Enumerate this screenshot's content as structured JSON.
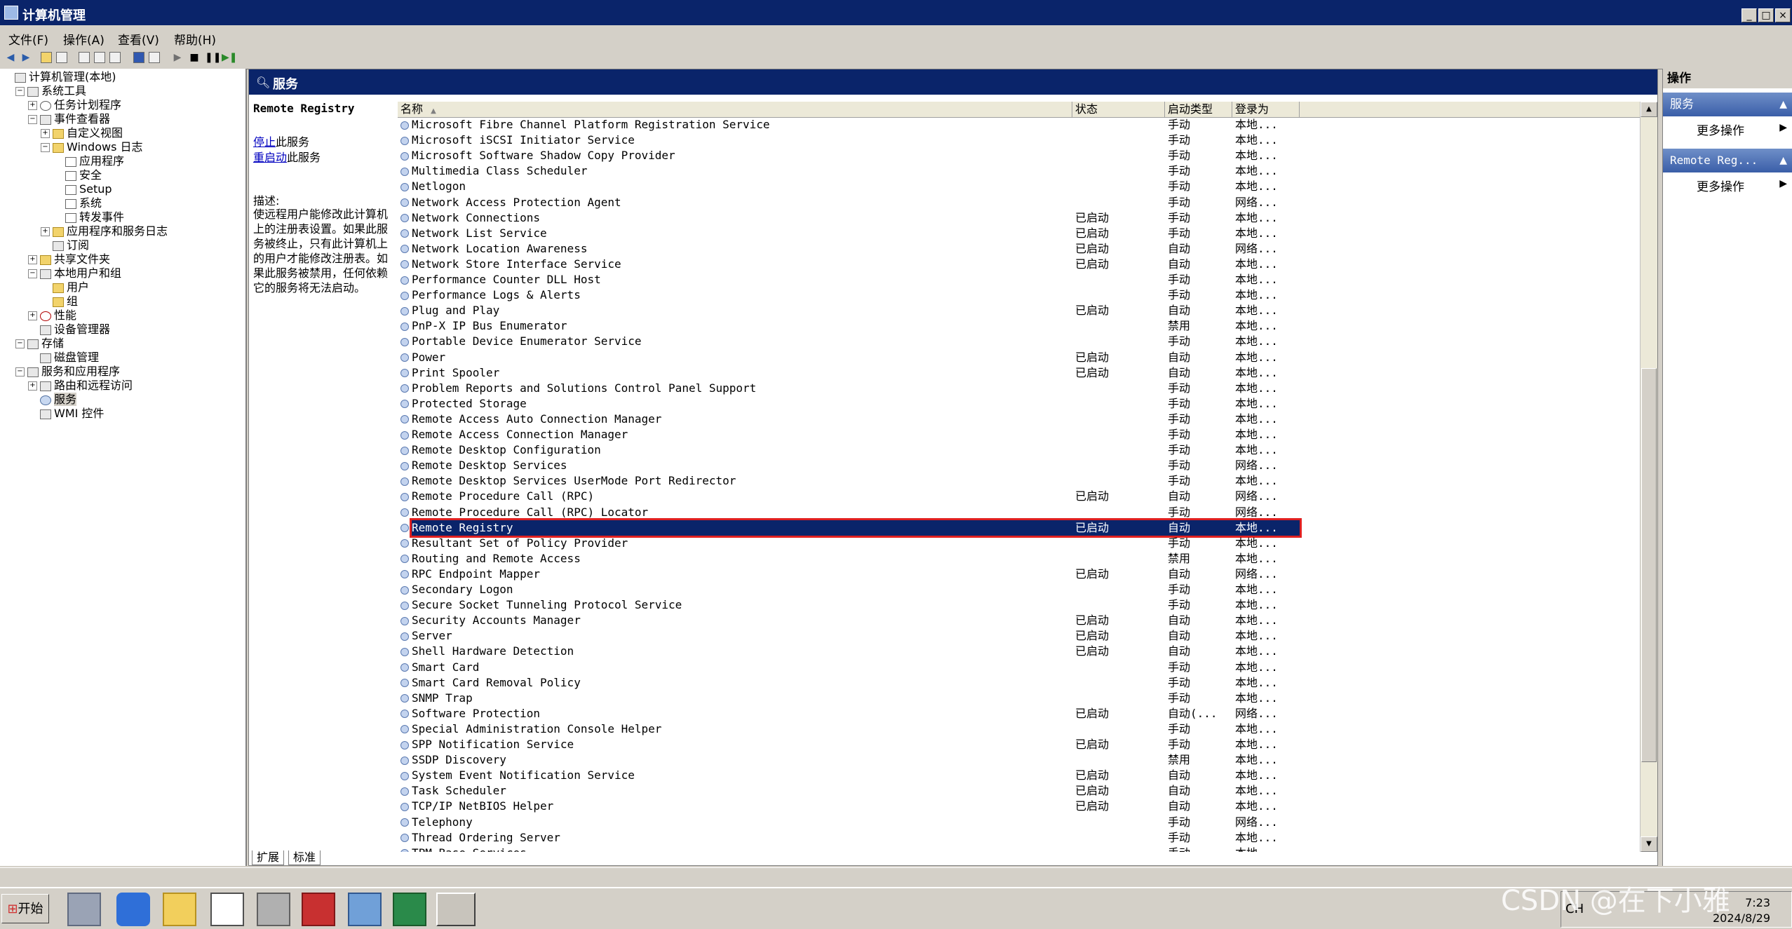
{
  "window": {
    "title": "计算机管理",
    "min": "_",
    "max": "□",
    "close": "×"
  },
  "menu": [
    "文件(F)",
    "操作(A)",
    "查看(V)",
    "帮助(H)"
  ],
  "tree": [
    {
      "label": "计算机管理(本地)",
      "level": 0,
      "icon": "computer-icon",
      "exp": ""
    },
    {
      "label": "系统工具",
      "level": 1,
      "icon": "tools-icon",
      "exp": "⊟"
    },
    {
      "label": "任务计划程序",
      "level": 2,
      "icon": "clock-icon",
      "exp": "⊞"
    },
    {
      "label": "事件查看器",
      "level": 2,
      "icon": "event-viewer-icon",
      "exp": "⊟"
    },
    {
      "label": "自定义视图",
      "level": 3,
      "icon": "folder-icon",
      "exp": "⊞"
    },
    {
      "label": "Windows 日志",
      "level": 3,
      "icon": "folder-icon",
      "exp": "⊟"
    },
    {
      "label": "应用程序",
      "level": 4,
      "icon": "log-icon",
      "exp": ""
    },
    {
      "label": "安全",
      "level": 4,
      "icon": "log-icon",
      "exp": ""
    },
    {
      "label": "Setup",
      "level": 4,
      "icon": "log-icon",
      "exp": ""
    },
    {
      "label": "系统",
      "level": 4,
      "icon": "log-icon",
      "exp": ""
    },
    {
      "label": "转发事件",
      "level": 4,
      "icon": "log-icon",
      "exp": ""
    },
    {
      "label": "应用程序和服务日志",
      "level": 3,
      "icon": "folder-icon",
      "exp": "⊞"
    },
    {
      "label": "订阅",
      "level": 3,
      "icon": "subscription-icon",
      "exp": ""
    },
    {
      "label": "共享文件夹",
      "level": 2,
      "icon": "shared-folder-icon",
      "exp": "⊞"
    },
    {
      "label": "本地用户和组",
      "level": 2,
      "icon": "users-icon",
      "exp": "⊟"
    },
    {
      "label": "用户",
      "level": 3,
      "icon": "folder-icon",
      "exp": ""
    },
    {
      "label": "组",
      "level": 3,
      "icon": "folder-icon",
      "exp": ""
    },
    {
      "label": "性能",
      "level": 2,
      "icon": "performance-icon",
      "exp": "⊞"
    },
    {
      "label": "设备管理器",
      "level": 2,
      "icon": "device-manager-icon",
      "exp": ""
    },
    {
      "label": "存储",
      "level": 1,
      "icon": "storage-icon",
      "exp": "⊟"
    },
    {
      "label": "磁盘管理",
      "level": 2,
      "icon": "disk-icon",
      "exp": ""
    },
    {
      "label": "服务和应用程序",
      "level": 1,
      "icon": "services-apps-icon",
      "exp": "⊟"
    },
    {
      "label": "路由和远程访问",
      "level": 2,
      "icon": "routing-icon",
      "exp": "⊞"
    },
    {
      "label": "服务",
      "level": 2,
      "icon": "gear-icon",
      "exp": "",
      "selected": true
    },
    {
      "label": "WMI 控件",
      "level": 2,
      "icon": "wmi-icon",
      "exp": ""
    }
  ],
  "center": {
    "title": "服务",
    "selected_service": "Remote Registry",
    "stop_link": "停止",
    "stop_rest": "此服务",
    "restart_link": "重启动",
    "restart_rest": "此服务",
    "desc_label": "描述:",
    "desc_text": "使远程用户能修改此计算机上的注册表设置。如果此服务被终止，只有此计算机上的用户才能修改注册表。如果此服务被禁用，任何依赖它的服务将无法启动。",
    "tab_extended": "扩展",
    "tab_standard": "标准"
  },
  "columns": [
    "名称",
    "状态",
    "启动类型",
    "登录为"
  ],
  "sort_indicator": "▲",
  "services": [
    [
      "Microsoft Fibre Channel Platform Registration Service",
      "",
      "手动",
      "本地..."
    ],
    [
      "Microsoft iSCSI Initiator Service",
      "",
      "手动",
      "本地..."
    ],
    [
      "Microsoft Software Shadow Copy Provider",
      "",
      "手动",
      "本地..."
    ],
    [
      "Multimedia Class Scheduler",
      "",
      "手动",
      "本地..."
    ],
    [
      "Netlogon",
      "",
      "手动",
      "本地..."
    ],
    [
      "Network Access Protection Agent",
      "",
      "手动",
      "网络..."
    ],
    [
      "Network Connections",
      "已启动",
      "手动",
      "本地..."
    ],
    [
      "Network List Service",
      "已启动",
      "手动",
      "本地..."
    ],
    [
      "Network Location Awareness",
      "已启动",
      "自动",
      "网络..."
    ],
    [
      "Network Store Interface Service",
      "已启动",
      "自动",
      "本地..."
    ],
    [
      "Performance Counter DLL Host",
      "",
      "手动",
      "本地..."
    ],
    [
      "Performance Logs & Alerts",
      "",
      "手动",
      "本地..."
    ],
    [
      "Plug and Play",
      "已启动",
      "自动",
      "本地..."
    ],
    [
      "PnP-X IP Bus Enumerator",
      "",
      "禁用",
      "本地..."
    ],
    [
      "Portable Device Enumerator Service",
      "",
      "手动",
      "本地..."
    ],
    [
      "Power",
      "已启动",
      "自动",
      "本地..."
    ],
    [
      "Print Spooler",
      "已启动",
      "自动",
      "本地..."
    ],
    [
      "Problem Reports and Solutions Control Panel Support",
      "",
      "手动",
      "本地..."
    ],
    [
      "Protected Storage",
      "",
      "手动",
      "本地..."
    ],
    [
      "Remote Access Auto Connection Manager",
      "",
      "手动",
      "本地..."
    ],
    [
      "Remote Access Connection Manager",
      "",
      "手动",
      "本地..."
    ],
    [
      "Remote Desktop Configuration",
      "",
      "手动",
      "本地..."
    ],
    [
      "Remote Desktop Services",
      "",
      "手动",
      "网络..."
    ],
    [
      "Remote Desktop Services UserMode Port Redirector",
      "",
      "手动",
      "本地..."
    ],
    [
      "Remote Procedure Call (RPC)",
      "已启动",
      "自动",
      "网络..."
    ],
    [
      "Remote Procedure Call (RPC) Locator",
      "",
      "手动",
      "网络..."
    ],
    [
      "Remote Registry",
      "已启动",
      "自动",
      "本地..."
    ],
    [
      "Resultant Set of Policy Provider",
      "",
      "手动",
      "本地..."
    ],
    [
      "Routing and Remote Access",
      "",
      "禁用",
      "本地..."
    ],
    [
      "RPC Endpoint Mapper",
      "已启动",
      "自动",
      "网络..."
    ],
    [
      "Secondary Logon",
      "",
      "手动",
      "本地..."
    ],
    [
      "Secure Socket Tunneling Protocol Service",
      "",
      "手动",
      "本地..."
    ],
    [
      "Security Accounts Manager",
      "已启动",
      "自动",
      "本地..."
    ],
    [
      "Server",
      "已启动",
      "自动",
      "本地..."
    ],
    [
      "Shell Hardware Detection",
      "已启动",
      "自动",
      "本地..."
    ],
    [
      "Smart Card",
      "",
      "手动",
      "本地..."
    ],
    [
      "Smart Card Removal Policy",
      "",
      "手动",
      "本地..."
    ],
    [
      "SNMP Trap",
      "",
      "手动",
      "本地..."
    ],
    [
      "Software Protection",
      "已启动",
      "自动(...",
      "网络..."
    ],
    [
      "Special Administration Console Helper",
      "",
      "手动",
      "本地..."
    ],
    [
      "SPP Notification Service",
      "已启动",
      "手动",
      "本地..."
    ],
    [
      "SSDP Discovery",
      "",
      "禁用",
      "本地..."
    ],
    [
      "System Event Notification Service",
      "已启动",
      "自动",
      "本地..."
    ],
    [
      "Task Scheduler",
      "已启动",
      "自动",
      "本地..."
    ],
    [
      "TCP/IP NetBIOS Helper",
      "已启动",
      "自动",
      "本地..."
    ],
    [
      "Telephony",
      "",
      "手动",
      "网络..."
    ],
    [
      "Thread Ordering Server",
      "",
      "手动",
      "本地..."
    ],
    [
      "TPM Base Services",
      "",
      "手动",
      "本地..."
    ]
  ],
  "selected_index": 26,
  "actions": {
    "header": "操作",
    "section1": "服务",
    "more1": "更多操作",
    "section2": "Remote Reg...",
    "more2": "更多操作"
  },
  "taskbar": {
    "start": "开始",
    "time": "7:23",
    "date": "2024/8/29",
    "ime": "CH"
  },
  "watermark": "CSDN @在下小雅"
}
